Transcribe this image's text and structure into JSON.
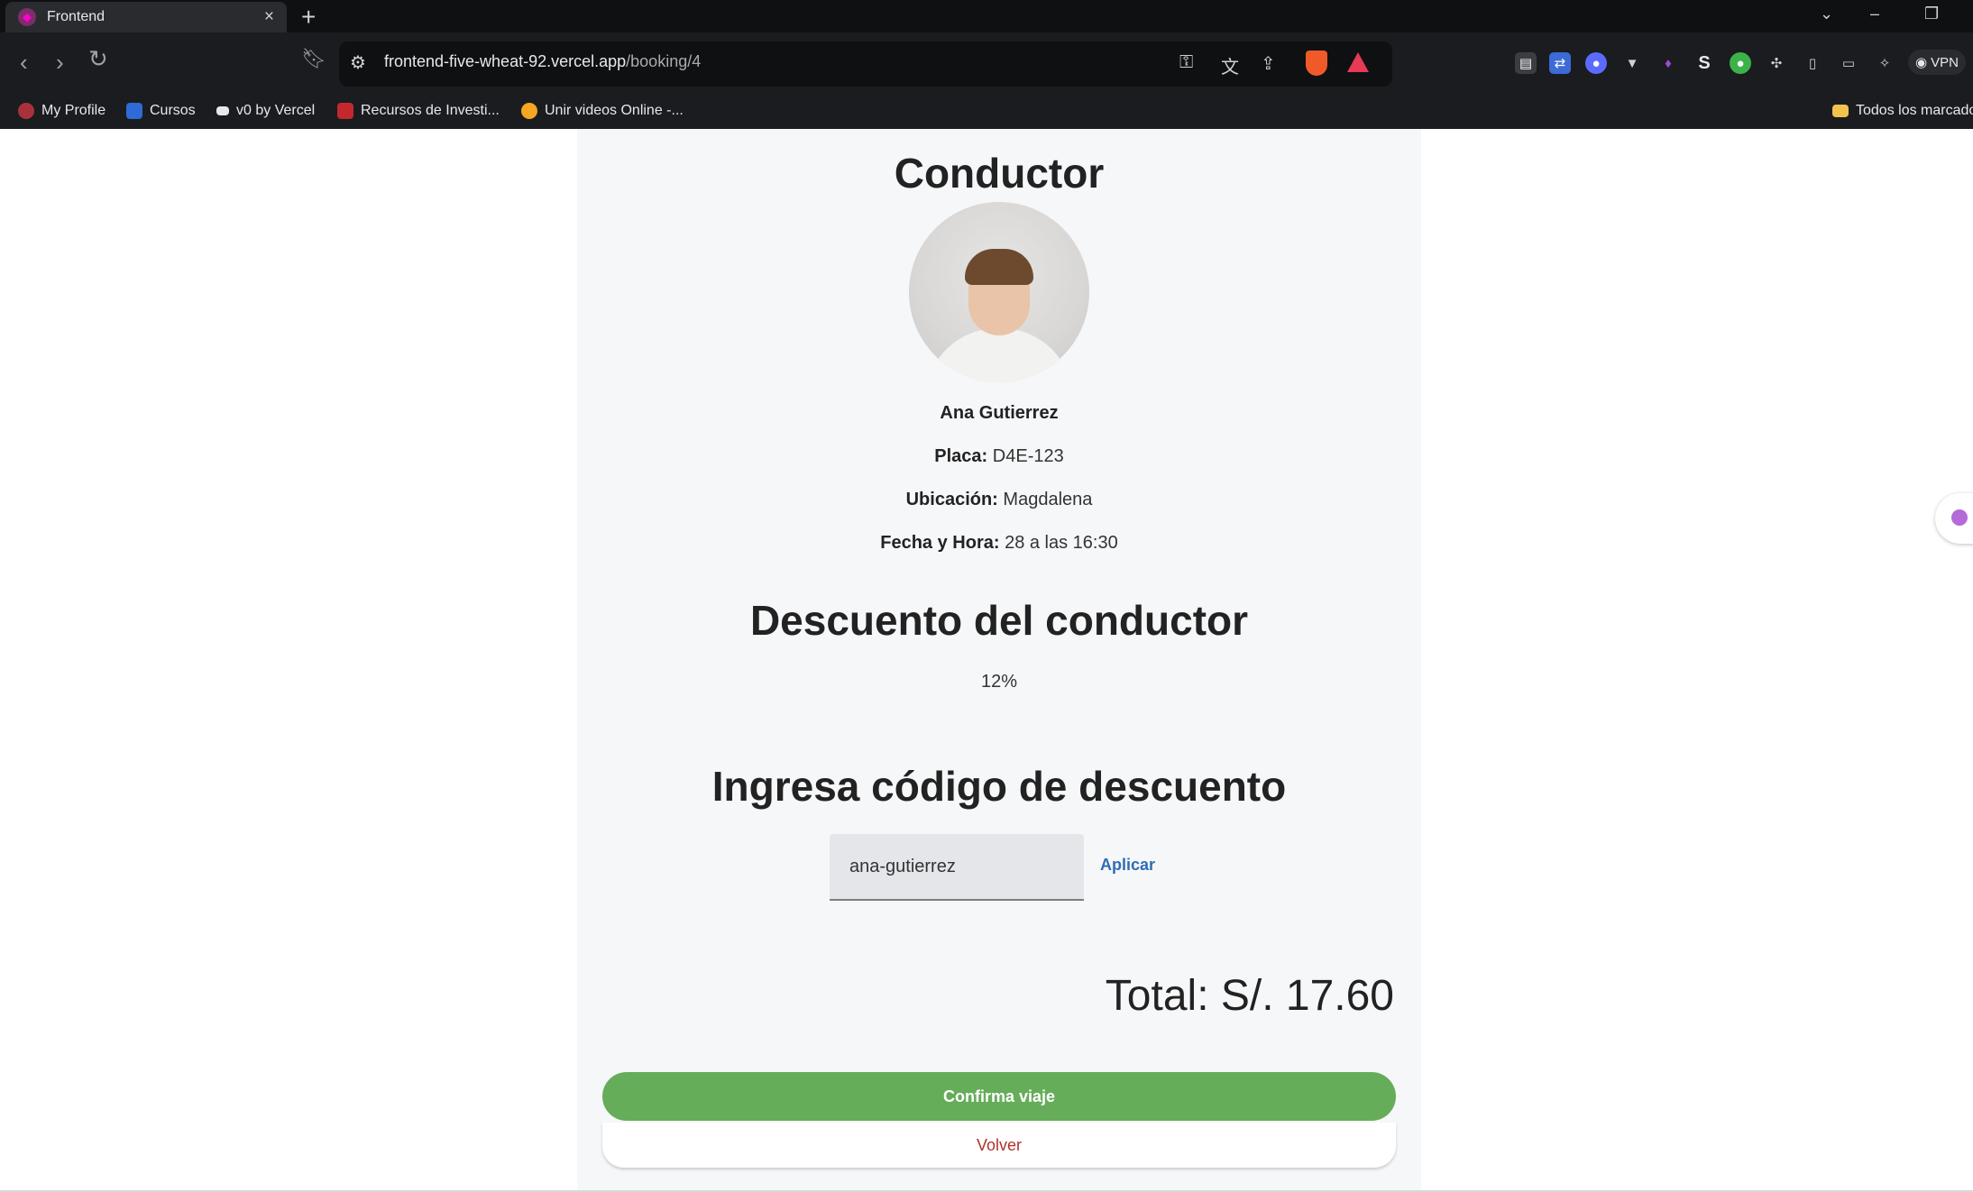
{
  "browser": {
    "tab_title": "Frontend",
    "tab_close": "×",
    "new_tab": "+",
    "window_controls": {
      "dropdown": "⌄",
      "minimize": "–",
      "restore": "❐"
    },
    "url_host": "frontend-five-wheat-92.vercel.app",
    "url_path": "/booking/4",
    "vpn_label": "VPN",
    "extensions": [
      "password-key-icon",
      "translate-icon",
      "share-icon",
      "brave-shield-icon",
      "brave-rewards-icon"
    ],
    "extension_colors": [
      "#3b6bd6",
      "#5b6bff",
      "#cfd0d3",
      "#a14ad6",
      "#e8e8ea",
      "#3cb34a"
    ],
    "bookmarks": [
      {
        "label": "My Profile",
        "color": "#a8323b"
      },
      {
        "label": "Cursos",
        "color": "#2f6bd6"
      },
      {
        "label": "v0 by Vercel",
        "color": "#e8e8ea"
      },
      {
        "label": "Recursos de Investi...",
        "color": "#c4282f"
      },
      {
        "label": "Unir videos Online -...",
        "color": "#f5a623"
      }
    ],
    "bookmarks_folder": "Todos los marcado"
  },
  "page": {
    "title": "Conductor",
    "driver_name": "Ana Gutierrez",
    "plate_label": "Placa:",
    "plate_value": "D4E-123",
    "location_label": "Ubicación:",
    "location_value": "Magdalena",
    "datetime_label": "Fecha y Hora:",
    "datetime_value": "28 a las 16:30",
    "discount_heading": "Descuento del conductor",
    "discount_value": "12%",
    "code_heading": "Ingresa código de descuento",
    "code_input_value": "ana-gutierrez",
    "apply_label": "Aplicar",
    "total": "Total: S/. 17.60",
    "confirm_label": "Confirma viaje",
    "back_label": "Volver"
  },
  "colors": {
    "confirm_button": "#66ad5a",
    "back_text": "#b2332c",
    "apply_link": "#2f6db3"
  }
}
